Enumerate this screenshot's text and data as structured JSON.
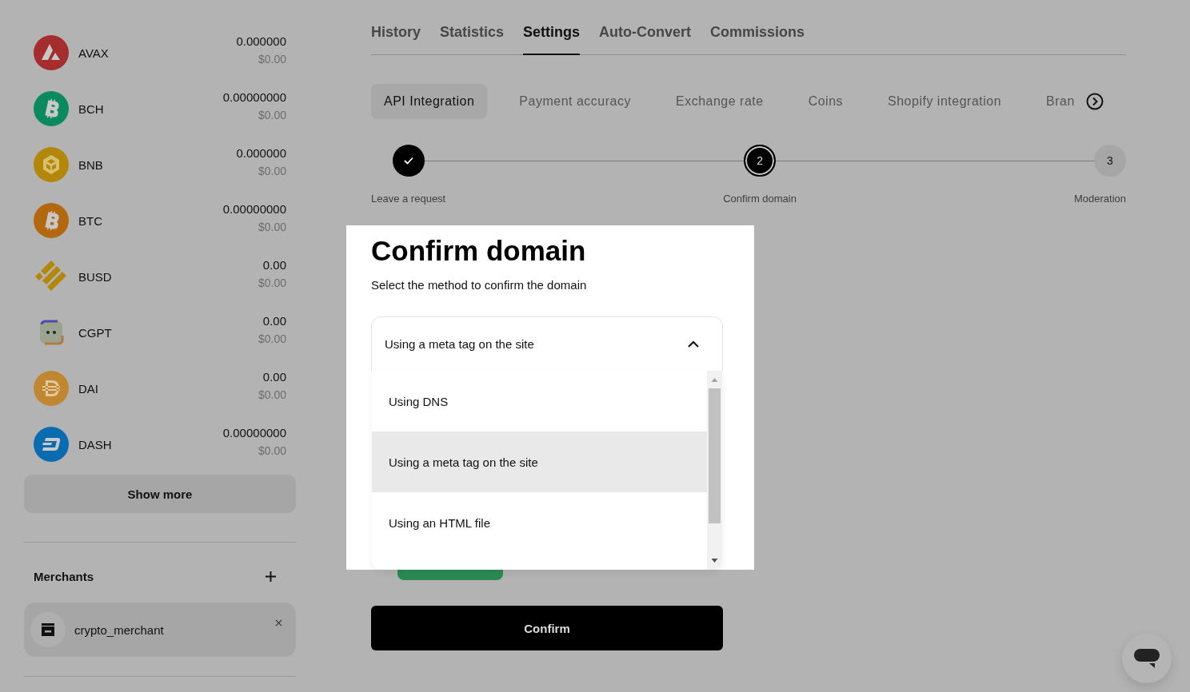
{
  "coins": [
    {
      "name": "AVAX",
      "kind": "avax",
      "color": "#a52d2d",
      "amount": "0.000000",
      "usd": "$0.00"
    },
    {
      "name": "BCH",
      "kind": "bitcoin",
      "color": "#0b8a60",
      "amount": "0.00000000",
      "usd": "$0.00"
    },
    {
      "name": "BNB",
      "kind": "bnb",
      "color": "#b3880a",
      "amount": "0.000000",
      "usd": "$0.00"
    },
    {
      "name": "BTC",
      "kind": "bitcoin",
      "color": "#b3680f",
      "amount": "0.00000000",
      "usd": "$0.00"
    },
    {
      "name": "BUSD",
      "kind": "busd",
      "color": "#b3880a",
      "amount": "0.00",
      "usd": "$0.00"
    },
    {
      "name": "CGPT",
      "kind": "robot",
      "color": "#9aa290",
      "amount": "0.00",
      "usd": "$0.00"
    },
    {
      "name": "DAI",
      "kind": "dai",
      "color": "#c08730",
      "amount": "0.00",
      "usd": "$0.00"
    },
    {
      "name": "DASH",
      "kind": "dash",
      "color": "#0a6cb0",
      "amount": "0.00000000",
      "usd": "$0.00"
    }
  ],
  "show_more": "Show more",
  "merchants": {
    "title": "Merchants",
    "items": [
      {
        "name": "crypto_merchant"
      }
    ]
  },
  "tabs": [
    {
      "label": "History",
      "selected": false
    },
    {
      "label": "Statistics",
      "selected": false
    },
    {
      "label": "Settings",
      "selected": true
    },
    {
      "label": "Auto-Convert",
      "selected": false
    },
    {
      "label": "Commissions",
      "selected": false
    }
  ],
  "subtabs": [
    {
      "label": "API Integration",
      "selected": true
    },
    {
      "label": "Payment accuracy",
      "selected": false
    },
    {
      "label": "Exchange rate",
      "selected": false
    },
    {
      "label": "Coins",
      "selected": false
    },
    {
      "label": "Shopify integration",
      "selected": false
    },
    {
      "label": "Bran",
      "selected": false
    }
  ],
  "steps": [
    {
      "label": "Leave a request",
      "completed": true,
      "selected": false
    },
    {
      "number": "2",
      "label": "Confirm domain",
      "completed": false,
      "selected": true
    },
    {
      "number": "3",
      "label": "Moderation",
      "completed": false,
      "selected": false
    }
  ],
  "panel": {
    "title": "Confirm domain",
    "subtitle": "Select the method to confirm the domain",
    "select": {
      "value": "Using a meta tag on the site",
      "expanded": true,
      "options": [
        {
          "label": "Using DNS",
          "selected": false
        },
        {
          "label": "Using a meta tag on the site",
          "selected": true
        },
        {
          "label": "Using an HTML file",
          "selected": false
        }
      ]
    }
  },
  "confirm_button": "Confirm"
}
